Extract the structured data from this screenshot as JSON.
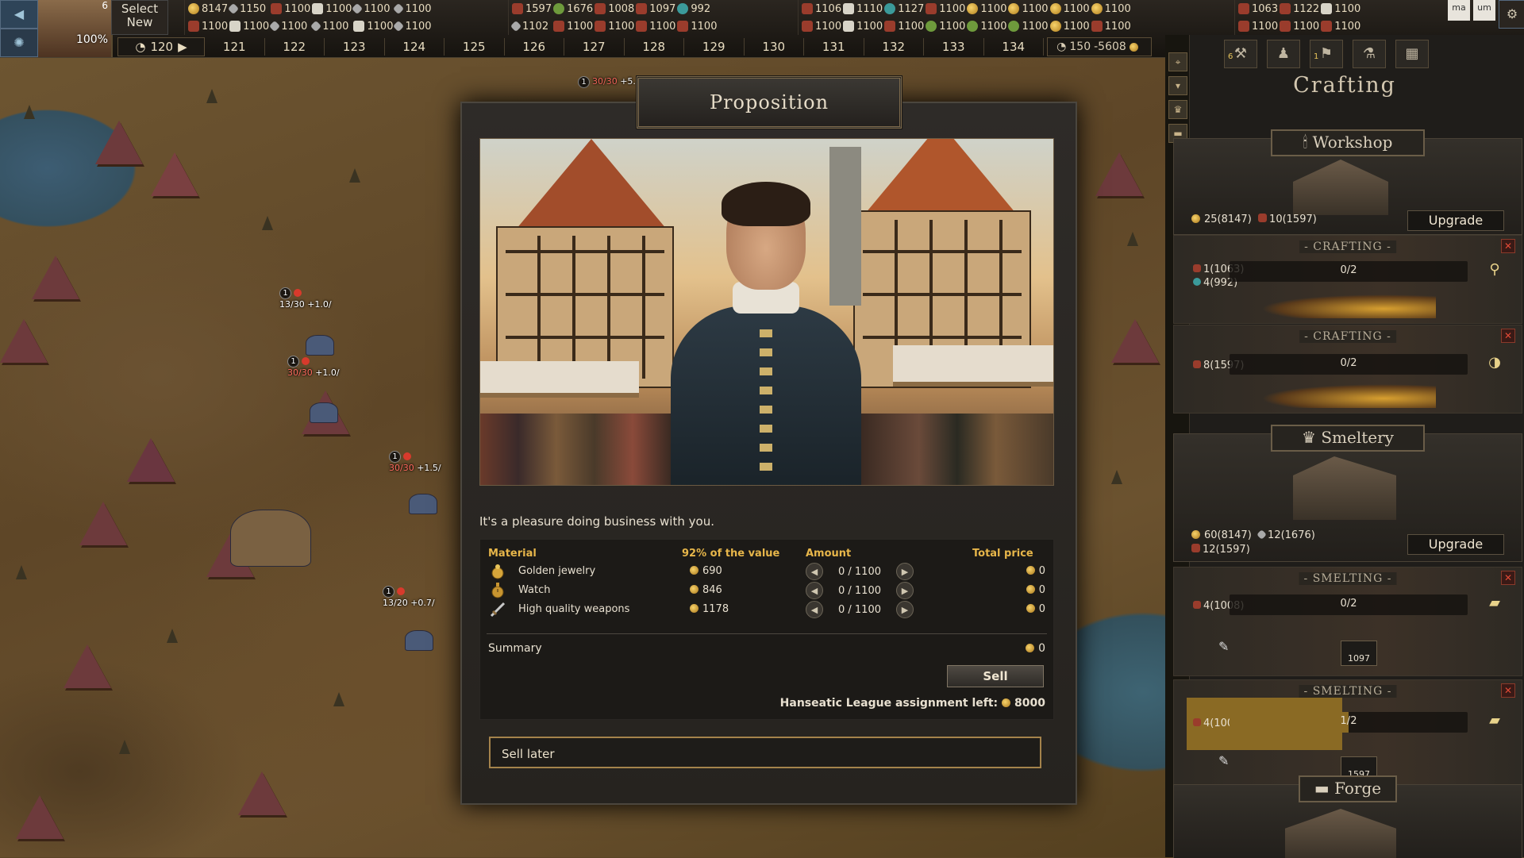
{
  "header": {
    "select_new": "Select New",
    "portrait_pct": "100%",
    "portrait_num": "6",
    "lang_buttons": [
      "ma",
      "um"
    ]
  },
  "resources": [
    {
      "row1": [
        {
          "v": "8147",
          "i": "gold"
        },
        {
          "v": "1150",
          "i": "silver"
        },
        {
          "v": "1100",
          "i": "red"
        },
        {
          "v": "1100",
          "i": "white"
        },
        {
          "v": "1100",
          "i": "silver"
        },
        {
          "v": "1100",
          "i": "silver"
        }
      ],
      "row2": [
        {
          "v": "1100",
          "i": "red"
        },
        {
          "v": "1100",
          "i": "white"
        },
        {
          "v": "1100",
          "i": "silver"
        },
        {
          "v": "1100",
          "i": "silver"
        },
        {
          "v": "1100",
          "i": "white"
        },
        {
          "v": "1100",
          "i": "silver"
        }
      ]
    },
    {
      "row1": [
        {
          "v": "1597",
          "i": "red"
        },
        {
          "v": "1676",
          "i": "green"
        },
        {
          "v": "1008",
          "i": "red"
        },
        {
          "v": "1097",
          "i": "red"
        },
        {
          "v": "992",
          "i": "teal"
        }
      ],
      "row2": [
        {
          "v": "1102",
          "i": "silver"
        },
        {
          "v": "1100",
          "i": "red"
        },
        {
          "v": "1100",
          "i": "red"
        },
        {
          "v": "1100",
          "i": "red"
        },
        {
          "v": "1100",
          "i": "red"
        }
      ]
    },
    {
      "row1": [
        {
          "v": "1106",
          "i": "red"
        },
        {
          "v": "1110",
          "i": "white"
        },
        {
          "v": "1127",
          "i": "teal"
        },
        {
          "v": "1100",
          "i": "red"
        },
        {
          "v": "1100",
          "i": "gold"
        },
        {
          "v": "1100",
          "i": "gold"
        },
        {
          "v": "1100",
          "i": "gold"
        },
        {
          "v": "1100",
          "i": "gold"
        }
      ],
      "row2": [
        {
          "v": "1100",
          "i": "red"
        },
        {
          "v": "1100",
          "i": "white"
        },
        {
          "v": "1100",
          "i": "red"
        },
        {
          "v": "1100",
          "i": "green"
        },
        {
          "v": "1100",
          "i": "green"
        },
        {
          "v": "1100",
          "i": "green"
        },
        {
          "v": "1100",
          "i": "gold"
        },
        {
          "v": "1100",
          "i": "red"
        }
      ]
    },
    {
      "row1": [
        {
          "v": "1063",
          "i": "red"
        },
        {
          "v": "1122",
          "i": "red"
        },
        {
          "v": "1100",
          "i": "white"
        }
      ],
      "row2": [
        {
          "v": "1100",
          "i": "red"
        },
        {
          "v": "1100",
          "i": "red"
        },
        {
          "v": "1100",
          "i": "red"
        }
      ]
    }
  ],
  "timeline": {
    "current": "120",
    "turns": [
      "121",
      "122",
      "123",
      "124",
      "125",
      "126",
      "127",
      "128",
      "129",
      "130",
      "131",
      "132",
      "133",
      "134"
    ],
    "end_turn": "150",
    "money": "-5608"
  },
  "map": {
    "settlements": [
      {
        "badge": "1",
        "label": "13/30",
        "rate": "+1.0/"
      },
      {
        "badge": "1",
        "label": "30/30",
        "rate": "+1.0/"
      },
      {
        "badge": "1",
        "label": "30/30",
        "rate": "+1.5/"
      },
      {
        "badge": "1",
        "label": "13/20",
        "rate": "+0.7/"
      },
      {
        "badge": "1",
        "label": "30/30",
        "rate": "+5."
      }
    ]
  },
  "modal": {
    "title": "Proposition",
    "greeting": "It's a pleasure doing business with you.",
    "headers": {
      "material": "Material",
      "value": "92% of the value",
      "amount": "Amount",
      "total": "Total price"
    },
    "items": [
      {
        "name": "Golden jewelry",
        "price": "690",
        "amount": "0 / 1100",
        "total": "0",
        "icon": "golden-jewelry-icon"
      },
      {
        "name": "Watch",
        "price": "846",
        "amount": "0 / 1100",
        "total": "0",
        "icon": "watch-icon"
      },
      {
        "name": "High quality weapons",
        "price": "1178",
        "amount": "0 / 1100",
        "total": "0",
        "icon": "weapons-icon"
      }
    ],
    "summary_label": "Summary",
    "summary_value": "0",
    "sell": "Sell",
    "league_label": "Hanseatic League assignment left:",
    "league_value": "8000",
    "sell_later": "Sell later"
  },
  "panel": {
    "title": "Crafting",
    "tab_badges": [
      "6",
      "1"
    ],
    "workshop": {
      "title": "Workshop",
      "cost1": "25(8147)",
      "cost2": "10(1597)",
      "upgrade": "Upgrade",
      "jobs": [
        {
          "label": "CRAFTING",
          "inputs": [
            "1(1063)",
            "4(992)"
          ],
          "progress": "0/2",
          "fill": 0
        },
        {
          "label": "CRAFTING",
          "inputs": [
            "8(1597)"
          ],
          "progress": "0/2",
          "fill": 0
        }
      ]
    },
    "smeltery": {
      "title": "Smeltery",
      "cost1": "60(8147)",
      "cost2": "12(1676)",
      "cost3": "12(1597)",
      "upgrade": "Upgrade",
      "jobs": [
        {
          "label": "SMELTING",
          "inputs": [
            "4(1008)"
          ],
          "progress": "0/2",
          "fill": 0,
          "qty": "1097"
        },
        {
          "label": "SMELTING",
          "inputs": [
            "4(1008)"
          ],
          "progress": "1/2",
          "fill": 0.5,
          "qty": "1597"
        }
      ]
    },
    "forge": {
      "title": "Forge"
    }
  },
  "colors": {
    "accent": "#e7b64a",
    "frame": "#a4834b",
    "danger": "#e04a36"
  }
}
